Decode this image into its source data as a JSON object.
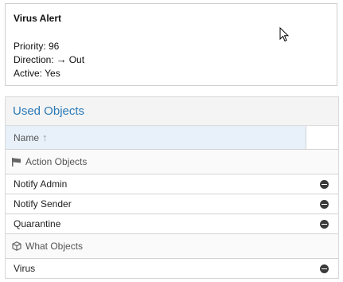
{
  "alert": {
    "title": "Virus Alert",
    "priority": "Priority: 96",
    "direction_label": "Direction:",
    "direction_icon": "→",
    "direction_value": "Out",
    "active": "Active: Yes"
  },
  "used_objects": {
    "header": "Used Objects",
    "column_name": "Name",
    "sort_icon": "↑",
    "groups": [
      {
        "label": "Action Objects",
        "icon": "flag-icon",
        "items": [
          "Notify Admin",
          "Notify Sender",
          "Quarantine"
        ]
      },
      {
        "label": "What Objects",
        "icon": "cube-icon",
        "items": [
          "Virus"
        ]
      }
    ]
  }
}
